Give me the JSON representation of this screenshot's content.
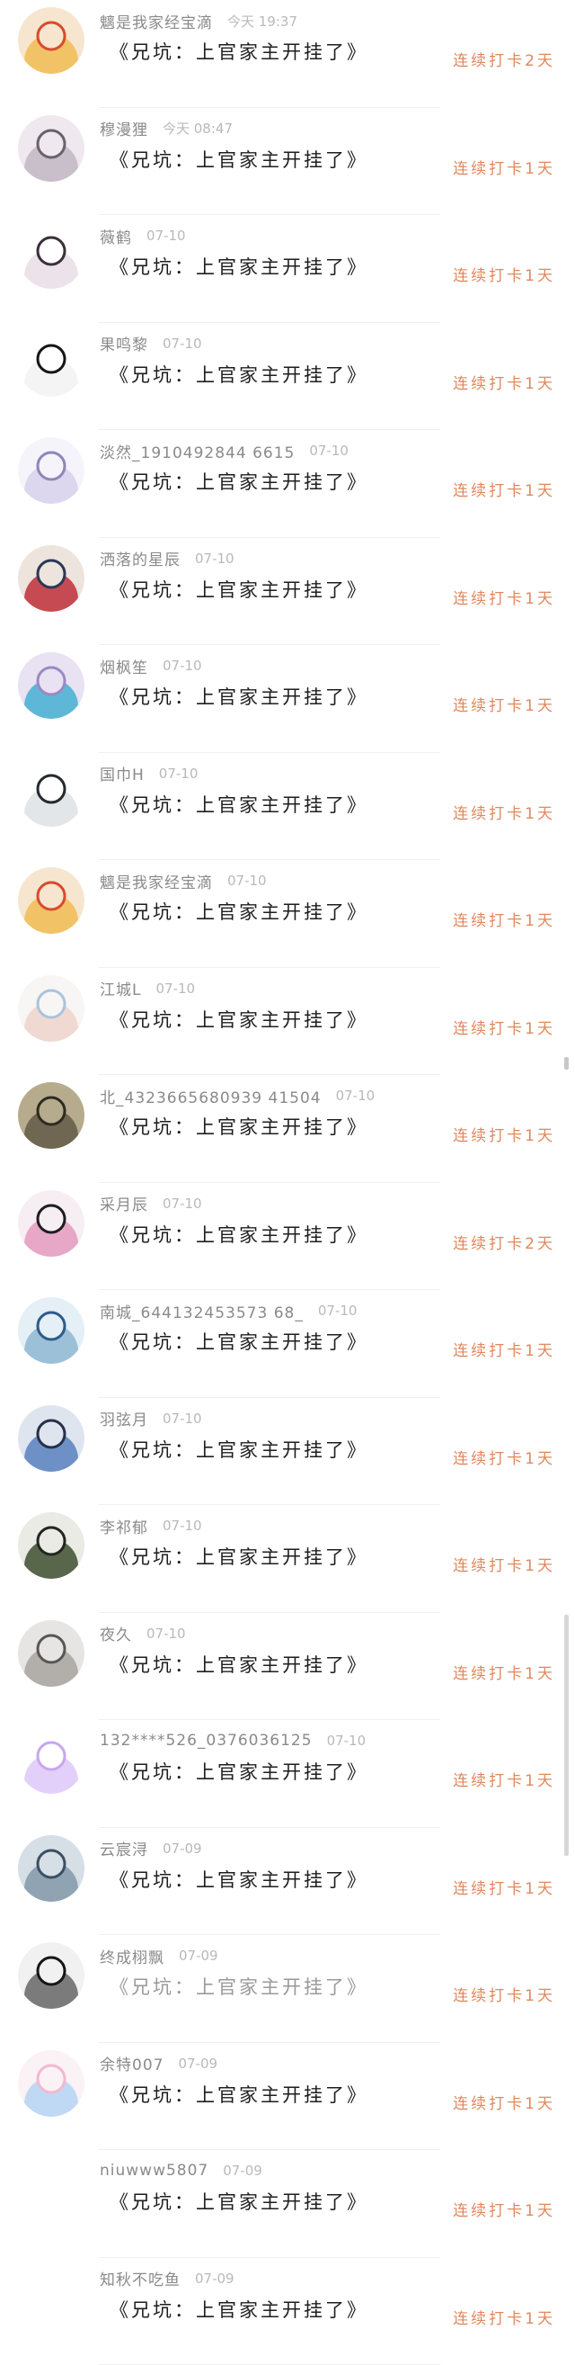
{
  "checkins": [
    {
      "user": "魑是我家经宝滴",
      "time": "今天 19:37",
      "title": "《兄坑：上官家主开挂了》",
      "streak": "连续打卡2天",
      "avatar_colors": [
        "#d94a2f",
        "#f2c267",
        "#f6e6cf"
      ]
    },
    {
      "user": "穆漫狸",
      "time": "今天 08:47",
      "title": "《兄坑：上官家主开挂了》",
      "streak": "连续打卡1天",
      "avatar_colors": [
        "#6a6170",
        "#c9bfca",
        "#efe8ee"
      ]
    },
    {
      "user": "薇鹤",
      "time": "07-10",
      "title": "《兄坑：上官家主开挂了》",
      "streak": "连续打卡1天",
      "avatar_colors": [
        "#3b2f3a",
        "#ece2e9",
        "#ffffff"
      ]
    },
    {
      "user": "果鸣黎",
      "time": "07-10",
      "title": "《兄坑：上官家主开挂了》",
      "streak": "连续打卡1天",
      "avatar_colors": [
        "#151515",
        "#f4f4f4",
        "#ffffff"
      ]
    },
    {
      "user": "淡然_1910492844 6615",
      "time": "07-10",
      "title": "《兄坑：上官家主开挂了》",
      "streak": "连续打卡1天",
      "avatar_colors": [
        "#8f86b8",
        "#dcd7ee",
        "#f6f4fb"
      ]
    },
    {
      "user": "洒落的星辰",
      "time": "07-10",
      "title": "《兄坑：上官家主开挂了》",
      "streak": "连续打卡1天",
      "avatar_colors": [
        "#2b3855",
        "#c64a52",
        "#ede4de"
      ]
    },
    {
      "user": "烟枫笙",
      "time": "07-10",
      "title": "《兄坑：上官家主开挂了》",
      "streak": "连续打卡1天",
      "avatar_colors": [
        "#9c88c4",
        "#5eb7d6",
        "#e8e2f3"
      ]
    },
    {
      "user": "国巾H",
      "time": "07-10",
      "title": "《兄坑：上官家主开挂了》",
      "streak": "连续打卡1天",
      "avatar_colors": [
        "#252a30",
        "#e3e6e8",
        "#ffffff"
      ]
    },
    {
      "user": "魑是我家经宝滴",
      "time": "07-10",
      "title": "《兄坑：上官家主开挂了》",
      "streak": "连续打卡1天",
      "avatar_colors": [
        "#d94a2f",
        "#f2c267",
        "#f6e6cf"
      ]
    },
    {
      "user": "江城L",
      "time": "07-10",
      "title": "《兄坑：上官家主开挂了》",
      "streak": "连续打卡1天",
      "avatar_colors": [
        "#a9c4dc",
        "#f0d9d2",
        "#f8f6f5"
      ]
    },
    {
      "user": "北_4323665680939 41504",
      "time": "07-10",
      "title": "《兄坑：上官家主开挂了》",
      "streak": "连续打卡1天",
      "avatar_colors": [
        "#2d2a22",
        "#6f6751",
        "#b6ab8d"
      ]
    },
    {
      "user": "采月辰",
      "time": "07-10",
      "title": "《兄坑：上官家主开挂了》",
      "streak": "连续打卡2天",
      "avatar_colors": [
        "#1d1d22",
        "#e7a7c6",
        "#f7eef4"
      ]
    },
    {
      "user": "南城_644132453573 68_",
      "time": "07-10",
      "title": "《兄坑：上官家主开挂了》",
      "streak": "连续打卡1天",
      "avatar_colors": [
        "#2d5b8a",
        "#9cc0d8",
        "#e4eff6"
      ]
    },
    {
      "user": "羽弦月",
      "time": "07-10",
      "title": "《兄坑：上官家主开挂了》",
      "streak": "连续打卡1天",
      "avatar_colors": [
        "#27304a",
        "#6d90c6",
        "#dfe5ef"
      ]
    },
    {
      "user": "李祁郁",
      "time": "07-10",
      "title": "《兄坑：上官家主开挂了》",
      "streak": "连续打卡1天",
      "avatar_colors": [
        "#23261f",
        "#58664c",
        "#e9ebe4"
      ]
    },
    {
      "user": "夜久",
      "time": "07-10",
      "title": "《兄坑：上官家主开挂了》",
      "streak": "连续打卡1天",
      "avatar_colors": [
        "#5a5653",
        "#b2aeaa",
        "#e7e5e3"
      ]
    },
    {
      "user": "132****526_0376036125",
      "time": "07-10",
      "title": "《兄坑：上官家主开挂了》",
      "streak": "连续打卡1天",
      "avatar_colors": [
        "#c8a6f0",
        "#e3d0fa",
        "#ffffff"
      ]
    },
    {
      "user": "云宸浔",
      "time": "07-09",
      "title": "《兄坑：上官家主开挂了》",
      "streak": "连续打卡1天",
      "avatar_colors": [
        "#3d4f63",
        "#8fa3b3",
        "#d6dfe6"
      ]
    },
    {
      "user": "终成栩飘",
      "time": "07-09",
      "title": "《兄坑：上官家主开挂了》",
      "streak": "连续打卡1天",
      "avatar_colors": [
        "#161616",
        "#7b7b7b",
        "#f1f1f1"
      ],
      "title_light": true
    },
    {
      "user": "余特007",
      "time": "07-09",
      "title": "《兄坑：上官家主开挂了》",
      "streak": "连续打卡1天",
      "avatar_colors": [
        "#f2b8d0",
        "#bfd9f4",
        "#fbf2f6"
      ]
    },
    {
      "user": "niuwww5807",
      "time": "07-09",
      "title": "《兄坑：上官家主开挂了》",
      "streak": "连续打卡1天",
      "avatar_colors": [
        "#ffffff",
        "#ffffff",
        "#ffffff"
      ],
      "no_avatar": true
    },
    {
      "user": "知秋不吃鱼",
      "time": "07-09",
      "title": "《兄坑：上官家主开挂了》",
      "streak": "连续打卡1天",
      "avatar_colors": [
        "#ffffff",
        "#ffffff",
        "#ffffff"
      ],
      "no_avatar": true
    }
  ]
}
